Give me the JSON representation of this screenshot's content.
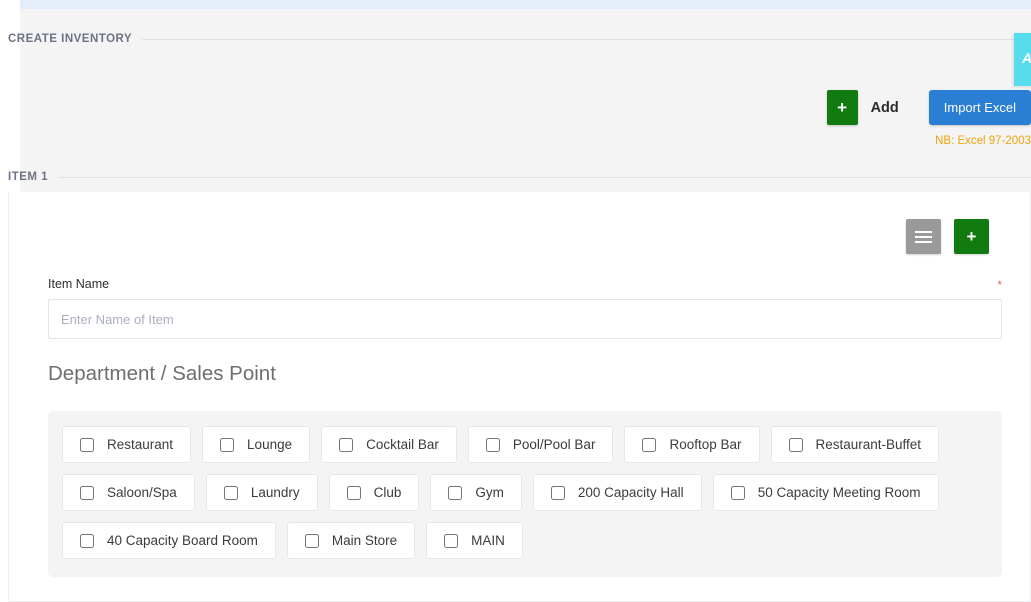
{
  "section": {
    "create_inventory_label": "CREATE INVENTORY",
    "item_label": "ITEM 1"
  },
  "toolbar": {
    "add_plus_icon": "+",
    "add_label": "Add",
    "import_excel_label": "Import Excel",
    "nb_note": "NB: Excel 97-2003"
  },
  "side_panel": {
    "partial_text": "A",
    "color": "#56dceb"
  },
  "card": {
    "menu_icon": "hamburger-icon",
    "plus_icon": "+"
  },
  "form": {
    "item_name_label": "Item Name",
    "item_name_value": "",
    "item_name_placeholder": "Enter Name of Item",
    "required_marker": "*"
  },
  "department": {
    "heading": "Department / Sales Point",
    "rows": [
      [
        "Restaurant",
        "Lounge",
        "Cocktail Bar",
        "Pool/Pool Bar",
        "Rooftop Bar",
        "Restaurant-Buffet"
      ],
      [
        "Saloon/Spa",
        "Laundry",
        "Club",
        "Gym",
        "200 Capacity Hall",
        "50 Capacity Meeting Room"
      ],
      [
        "40 Capacity Board Room",
        "Main Store",
        "MAIN"
      ]
    ]
  },
  "colors": {
    "green": "#117a11",
    "blue": "#2a7fd4",
    "orange": "#f0a30a",
    "gray": "#9a9a9a",
    "page_bg": "#f4f4f5"
  }
}
